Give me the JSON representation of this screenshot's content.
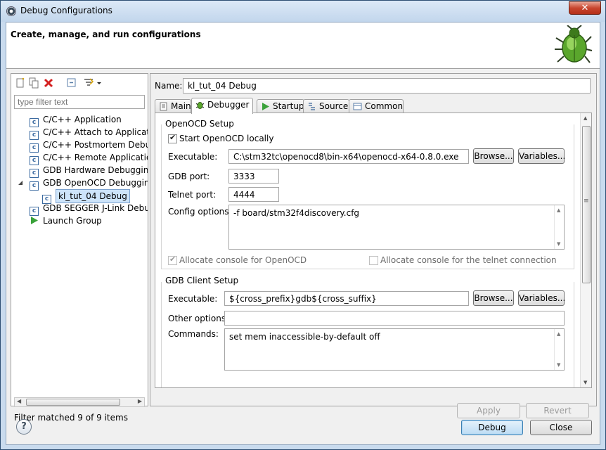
{
  "window": {
    "title": "Debug Configurations",
    "close_glyph": "✕"
  },
  "header": {
    "title": "Create, manage, and run configurations",
    "icon": "bug-icon"
  },
  "left": {
    "filter_placeholder": "type filter text",
    "tree": [
      {
        "label": "C/C++ Application",
        "icon": "c-config-icon"
      },
      {
        "label": "C/C++ Attach to Applicatio",
        "icon": "c-config-icon"
      },
      {
        "label": "C/C++ Postmortem Debug",
        "icon": "c-config-icon"
      },
      {
        "label": "C/C++ Remote Applicatior",
        "icon": "c-config-icon"
      },
      {
        "label": "GDB Hardware Debugging",
        "icon": "c-config-icon"
      },
      {
        "label": "GDB OpenOCD Debugging",
        "icon": "c-config-icon",
        "expanded": true
      },
      {
        "label": "kl_tut_04 Debug",
        "icon": "c-config-icon",
        "selected": true,
        "child": true
      },
      {
        "label": "GDB SEGGER J-Link Debug",
        "icon": "c-config-icon"
      },
      {
        "label": "Launch Group",
        "icon": "launch-icon"
      }
    ],
    "status": "Filter matched 9 of 9 items"
  },
  "right": {
    "name_label": "Name:",
    "name_value": "kl_tut_04 Debug",
    "tabs": [
      {
        "label": "Main"
      },
      {
        "label": "Debugger",
        "active": true
      },
      {
        "label": "Startup"
      },
      {
        "label": "Source"
      },
      {
        "label": "Common"
      }
    ],
    "openocd": {
      "title": "OpenOCD Setup",
      "start_locally": "Start OpenOCD locally",
      "executable_label": "Executable:",
      "executable_value": "C:\\stm32tc\\openocd8\\bin-x64\\openocd-x64-0.8.0.exe",
      "browse": "Browse...",
      "variables": "Variables...",
      "gdb_port_label": "GDB port:",
      "gdb_port": "3333",
      "telnet_port_label": "Telnet port:",
      "telnet_port": "4444",
      "config_label": "Config options:",
      "config_value": "-f board/stm32f4discovery.cfg",
      "alloc_console": "Allocate console for OpenOCD",
      "alloc_telnet": "Allocate console for the telnet connection"
    },
    "gdb_client": {
      "title": "GDB Client Setup",
      "executable_label": "Executable:",
      "executable_value": "${cross_prefix}gdb${cross_suffix}",
      "browse": "Browse...",
      "variables": "Variables...",
      "other_label": "Other options:",
      "other_value": "",
      "commands_label": "Commands:",
      "commands_value": "set mem inaccessible-by-default off"
    },
    "apply": "Apply",
    "revert": "Revert"
  },
  "footer": {
    "help": "?",
    "debug": "Debug",
    "close": "Close"
  }
}
